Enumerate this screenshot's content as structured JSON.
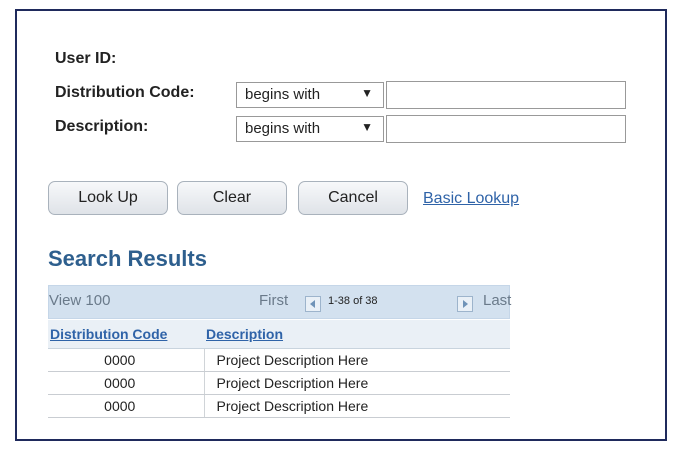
{
  "form": {
    "user_id_label": "User ID:",
    "distribution_code_label": "Distribution Code:",
    "distribution_code_operator": "begins with",
    "distribution_code_value": "",
    "description_label": "Description:",
    "description_operator": "begins with",
    "description_value": ""
  },
  "buttons": {
    "look_up": "Look Up",
    "clear": "Clear",
    "cancel": "Cancel",
    "basic_lookup": "Basic Lookup"
  },
  "results": {
    "title": "Search Results",
    "view_label": "View 100",
    "first_label": "First",
    "range_label": "1-38 of 38",
    "last_label": "Last",
    "columns": [
      "Distribution Code",
      "Description"
    ],
    "rows": [
      {
        "code": "0000",
        "description": "Project Description Here"
      },
      {
        "code": "0000",
        "description": "Project Description Here"
      },
      {
        "code": "0000",
        "description": "Project Description Here"
      }
    ]
  },
  "icons": {
    "select_arrow": "dropdown-arrow-icon",
    "prev": "previous-arrow-icon",
    "next": "next-arrow-icon"
  },
  "colors": {
    "frame_border": "#1f2a5c",
    "link": "#2f63a8",
    "section_title": "#2e5f8e",
    "nav_bar": "#d3e1ef"
  }
}
